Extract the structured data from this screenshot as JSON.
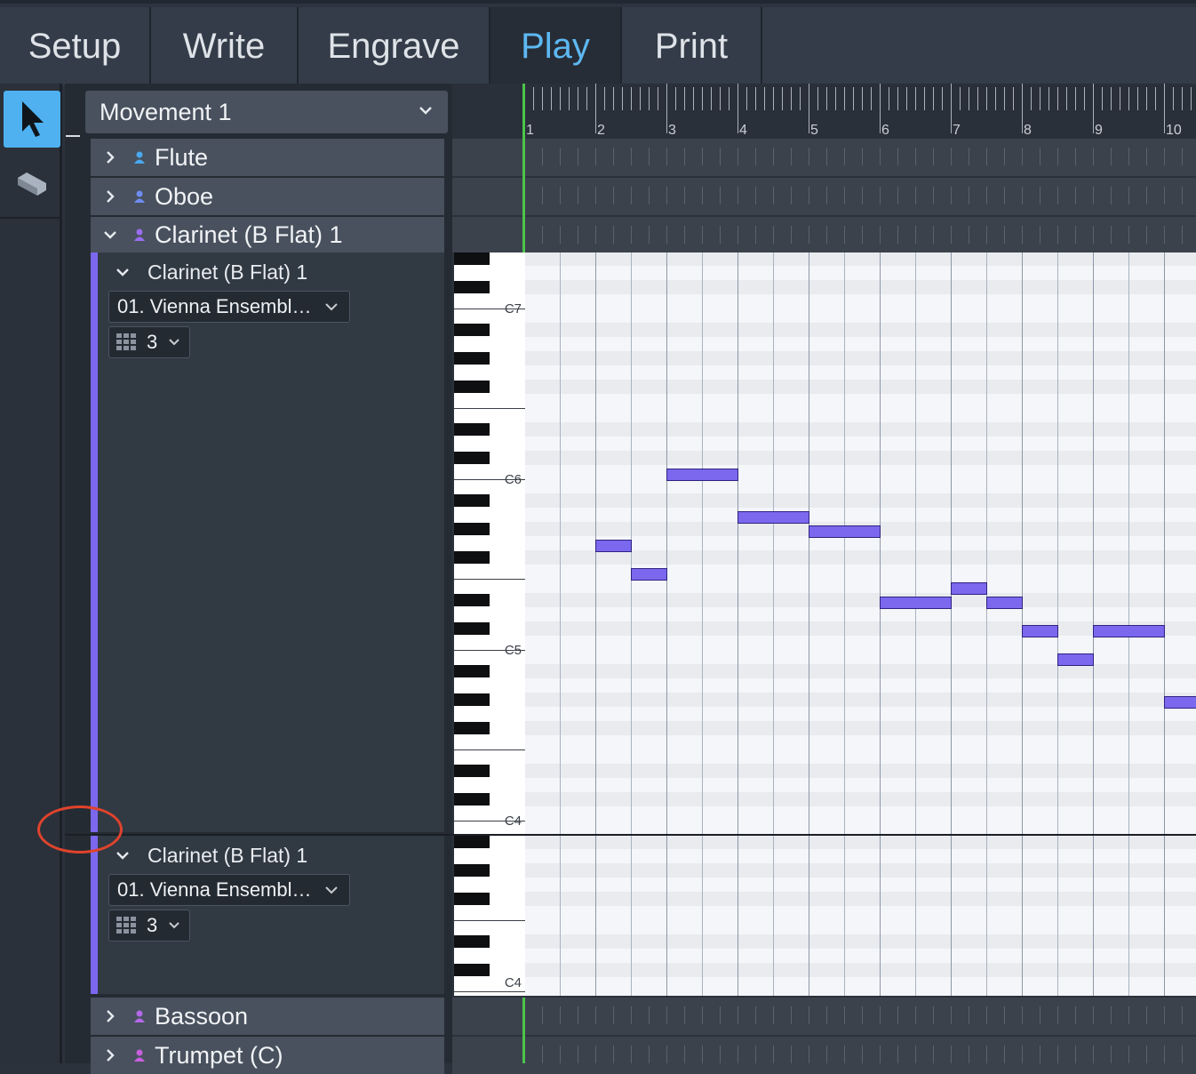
{
  "tabs": [
    {
      "label": "Setup",
      "active": false
    },
    {
      "label": "Write",
      "active": false
    },
    {
      "label": "Engrave",
      "active": false
    },
    {
      "label": "Play",
      "active": true
    },
    {
      "label": "Print",
      "active": false
    }
  ],
  "tools": {
    "select_icon": "arrow-pointer-icon",
    "draw_icon": "pencil-eraser-icon"
  },
  "movement": {
    "label": "Movement 1"
  },
  "tracks": {
    "flute": "Flute",
    "oboe": "Oboe",
    "clarinet": "Clarinet (B Flat) 1",
    "bassoon": "Bassoon",
    "trumpet": "Trumpet (C)"
  },
  "clarinet_sub1": {
    "title": "Clarinet (B Flat) 1",
    "sound": "01. Vienna Ensembl…",
    "channel": "3"
  },
  "clarinet_sub2": {
    "title": "Clarinet (B Flat) 1",
    "sound": "01. Vienna Ensembl…",
    "channel": "3"
  },
  "ruler": {
    "bars": [
      "1",
      "2",
      "3",
      "4",
      "5",
      "6",
      "7",
      "8",
      "9",
      "10"
    ]
  },
  "keyboard_labels": {
    "c7": "C7",
    "c6": "C6",
    "c5": "C5",
    "c4": "C4",
    "c4b": "C4"
  },
  "colors": {
    "accent": "#5db8f2",
    "note": "#7b68ee",
    "playhead": "#4cc44a",
    "annotation": "#e0432c"
  },
  "notes": [
    {
      "bar": 2.0,
      "len": 0.5,
      "pitch": "G5"
    },
    {
      "bar": 2.5,
      "len": 0.5,
      "pitch": "F5"
    },
    {
      "bar": 3.0,
      "len": 1.0,
      "pitch": "C6"
    },
    {
      "bar": 4.0,
      "len": 1.0,
      "pitch": "A5"
    },
    {
      "bar": 5.0,
      "len": 1.0,
      "pitch": "G#5"
    },
    {
      "bar": 6.0,
      "len": 1.0,
      "pitch": "D#5"
    },
    {
      "bar": 7.0,
      "len": 0.5,
      "pitch": "E5"
    },
    {
      "bar": 7.5,
      "len": 0.5,
      "pitch": "D#5"
    },
    {
      "bar": 8.0,
      "len": 0.5,
      "pitch": "C#5"
    },
    {
      "bar": 8.5,
      "len": 0.5,
      "pitch": "B4"
    },
    {
      "bar": 9.0,
      "len": 1.0,
      "pitch": "C#5"
    },
    {
      "bar": 10.0,
      "len": 0.5,
      "pitch": "G#4"
    }
  ]
}
